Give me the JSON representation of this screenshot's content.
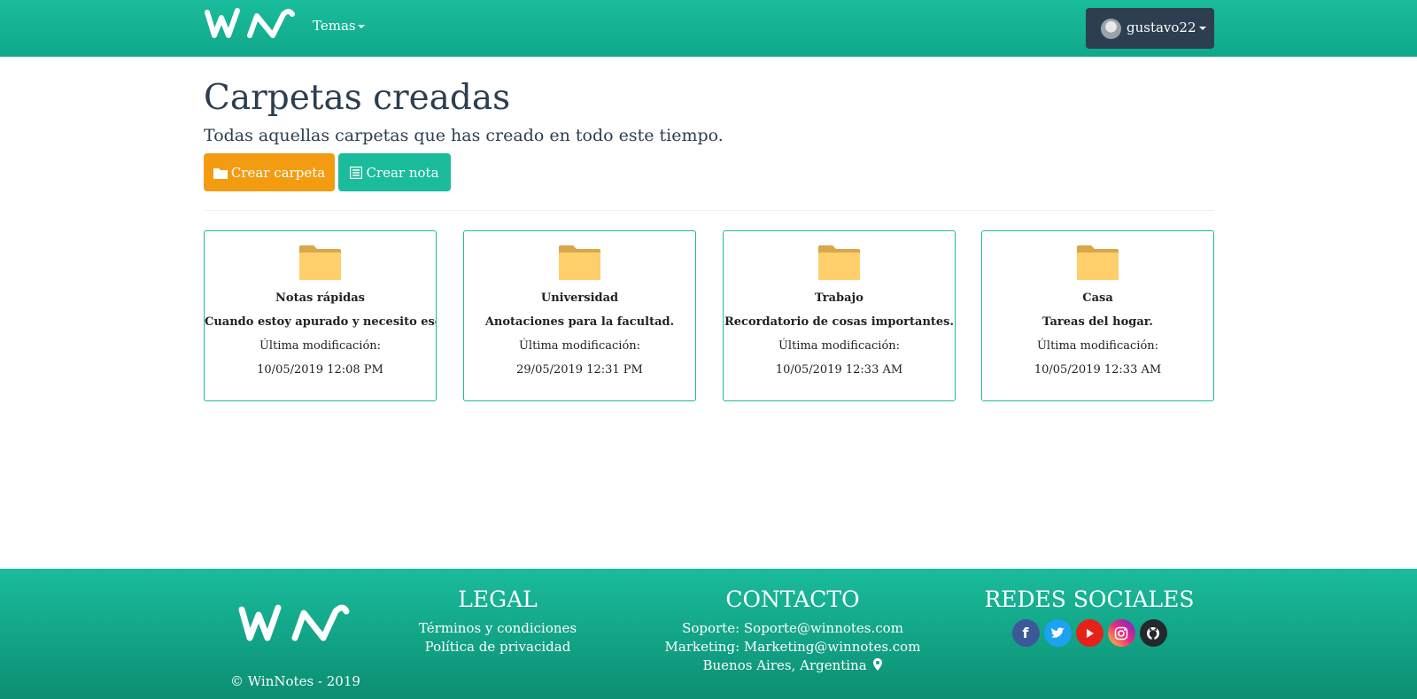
{
  "navbar": {
    "logo_text": "WN",
    "temas_label": "Temas",
    "user": {
      "name": "gustavo22"
    }
  },
  "main": {
    "title": "Carpetas creadas",
    "subtitle": "Todas aquellas carpetas que has creado en todo este tiempo.",
    "buttons": {
      "create_folder": "Crear carpeta",
      "create_note": "Crear nota"
    },
    "folders": [
      {
        "name": "Notas rápidas",
        "description": "Cuando estoy apurado y necesito esc...",
        "modified_label": "Última modificación:",
        "modified": "10/05/2019 12:08 PM"
      },
      {
        "name": "Universidad",
        "description": "Anotaciones para la facultad.",
        "modified_label": "Última modificación:",
        "modified": "29/05/2019 12:31 PM"
      },
      {
        "name": "Trabajo",
        "description": "Recordatorio de cosas importantes.",
        "modified_label": "Última modificación:",
        "modified": "10/05/2019 12:33 AM"
      },
      {
        "name": "Casa",
        "description": "Tareas del hogar.",
        "modified_label": "Última modificación:",
        "modified": "10/05/2019 12:33 AM"
      }
    ]
  },
  "footer": {
    "logo_text": "WN",
    "copyright": "© WinNotes - 2019",
    "legal": {
      "title": "LEGAL",
      "links": [
        "Términos y condiciones",
        "Política de privacidad"
      ]
    },
    "contacto": {
      "title": "CONTACTO",
      "lines": [
        "Soporte: Soporte@winnotes.com",
        "Marketing: Marketing@winnotes.com",
        "Buenos Aires, Argentina"
      ]
    },
    "redes": {
      "title": "REDES SOCIALES",
      "icons": [
        "facebook-icon",
        "twitter-icon",
        "youtube-icon",
        "instagram-icon",
        "github-icon"
      ]
    }
  },
  "colors": {
    "primary": "#1abc9c",
    "dark": "#2c3e50",
    "warning": "#f39c12",
    "folder": "#fecf6a"
  }
}
